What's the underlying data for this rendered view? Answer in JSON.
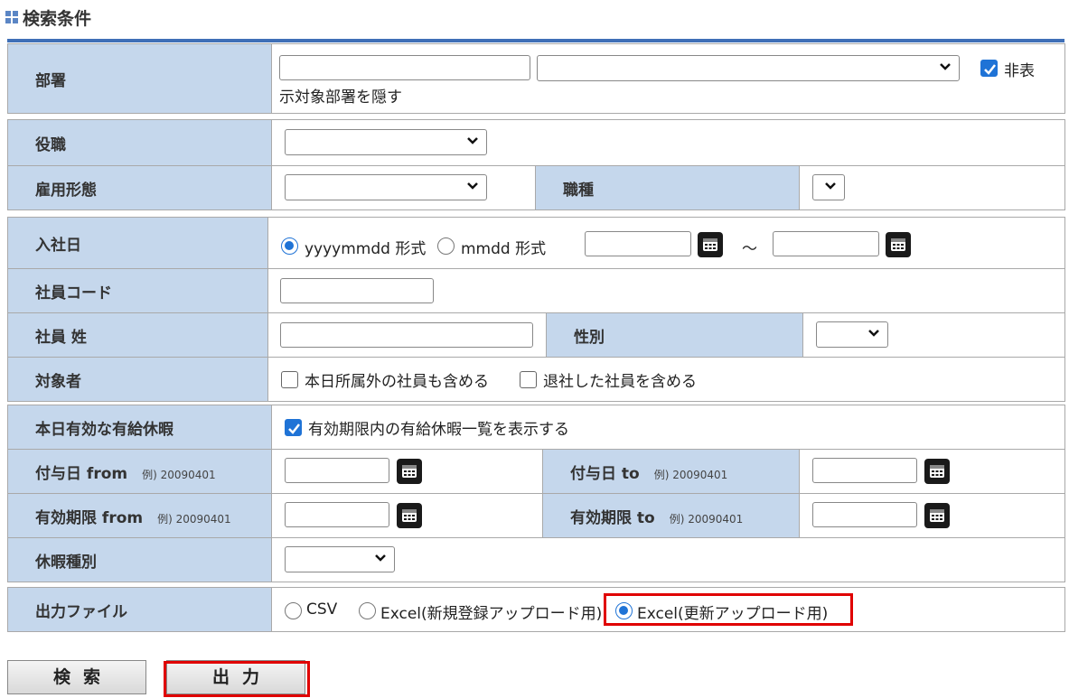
{
  "header": {
    "title": "検索条件"
  },
  "department": {
    "label": "部署",
    "code_value": "",
    "select_value": "",
    "hide_checkbox_checked": true,
    "hide_label_line1": "非表",
    "hide_label_line2": "示対象部署を隠す"
  },
  "position": {
    "label": "役職",
    "value": ""
  },
  "employment_type": {
    "label": "雇用形態",
    "value": ""
  },
  "job_type": {
    "label": "職種",
    "value": ""
  },
  "hire_date": {
    "label": "入社日",
    "format_options": [
      "yyyymmdd 形式",
      "mmdd 形式"
    ],
    "selected_format": "yyyymmdd 形式",
    "from_value": "",
    "to_value": "",
    "separator": "～"
  },
  "employee_code": {
    "label": "社員コード",
    "value": ""
  },
  "employee_last_name": {
    "label": "社員 姓",
    "value": ""
  },
  "gender": {
    "label": "性別",
    "value": ""
  },
  "target": {
    "label": "対象者",
    "options": [
      {
        "label": "本日所属外の社員も含める",
        "checked": false
      },
      {
        "label": "退社した社員を含める",
        "checked": false
      }
    ]
  },
  "valid_leave": {
    "label": "本日有効な有給休暇",
    "checkbox_label": "有効期限内の有給休暇一覧を表示する",
    "checked": true
  },
  "grant_date_from": {
    "label": "付与日 from",
    "example": "例) 20090401",
    "value": ""
  },
  "grant_date_to": {
    "label": "付与日 to",
    "example": "例) 20090401",
    "value": ""
  },
  "expiry_from": {
    "label": "有効期限 from",
    "example": "例) 20090401",
    "value": ""
  },
  "expiry_to": {
    "label": "有効期限 to",
    "example": "例) 20090401",
    "value": ""
  },
  "leave_type": {
    "label": "休暇種別",
    "value": ""
  },
  "output_file": {
    "label": "出力ファイル",
    "options": [
      "CSV",
      "Excel(新規登録アップロード用)",
      "Excel(更新アップロード用)"
    ],
    "selected": "Excel(更新アップロード用)"
  },
  "buttons": {
    "search": "検索",
    "output": "出力"
  },
  "colors": {
    "label_bg": "#c5d7ec",
    "accent": "#1f73d6",
    "highlight": "#e00000"
  }
}
